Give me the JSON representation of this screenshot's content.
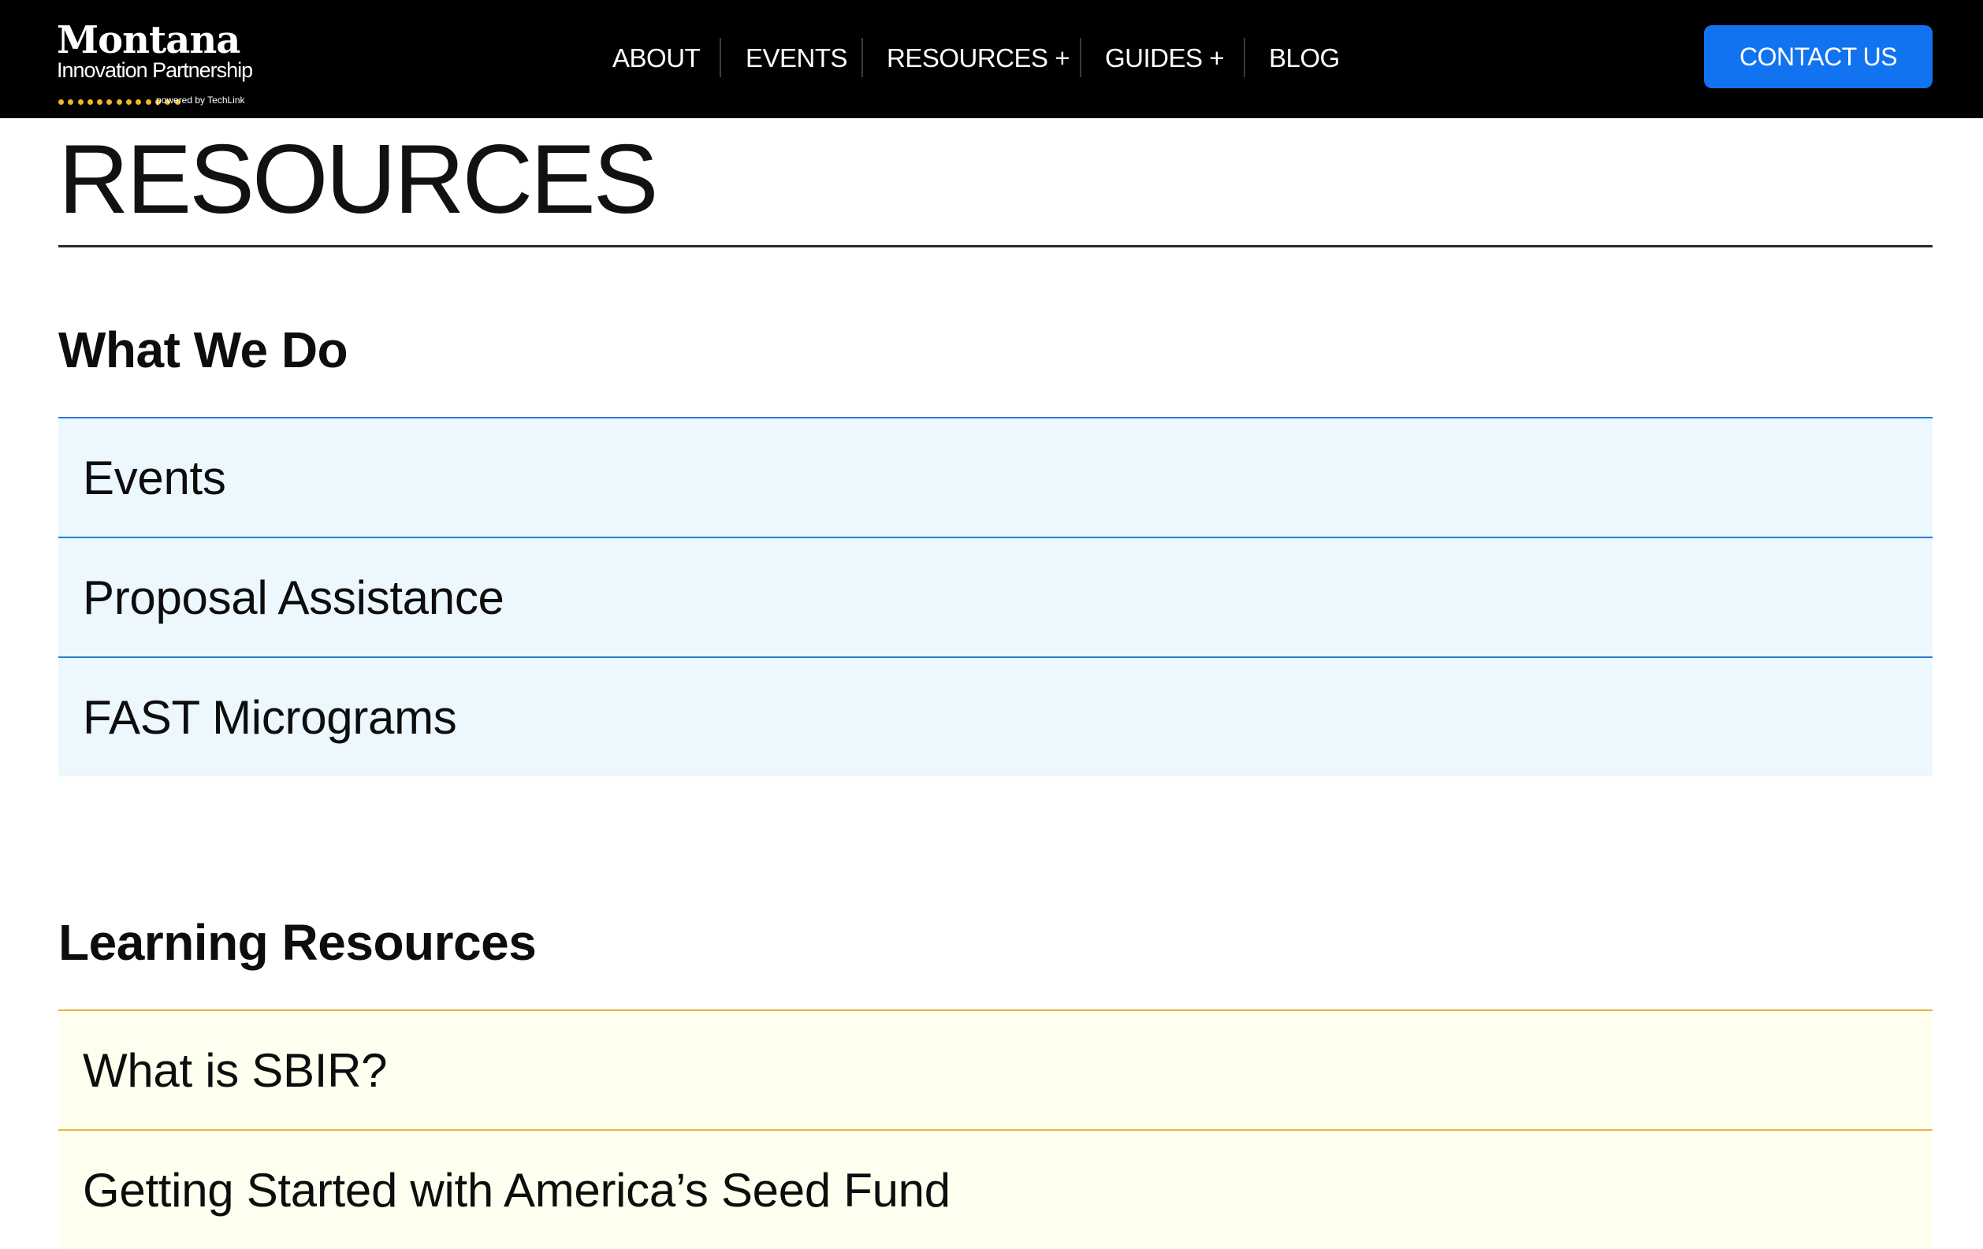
{
  "header": {
    "logo": {
      "title": "Montana",
      "subtitle": "Innovation Partnership",
      "powered_by": "powered by TechLink",
      "dot_color": "#f2b52a"
    },
    "nav": [
      {
        "label": "ABOUT"
      },
      {
        "label": "EVENTS"
      },
      {
        "label": "RESOURCES +"
      },
      {
        "label": "GUIDES +"
      },
      {
        "label": "BLOG"
      }
    ],
    "contact_label": "CONTACT US",
    "contact_color": "#1273f0"
  },
  "page": {
    "title": "RESOURCES"
  },
  "sections": [
    {
      "heading": "What We Do",
      "accent": "#2a7ad0",
      "background": "#ecf7fe",
      "items": [
        {
          "label": "Events"
        },
        {
          "label": "Proposal Assistance"
        },
        {
          "label": "FAST Micrograms"
        }
      ]
    },
    {
      "heading": "Learning Resources",
      "accent": "#e8b63a",
      "background": "#fffff0",
      "items": [
        {
          "label": "What is SBIR?"
        },
        {
          "label": "Getting Started with America’s Seed Fund"
        }
      ]
    }
  ]
}
